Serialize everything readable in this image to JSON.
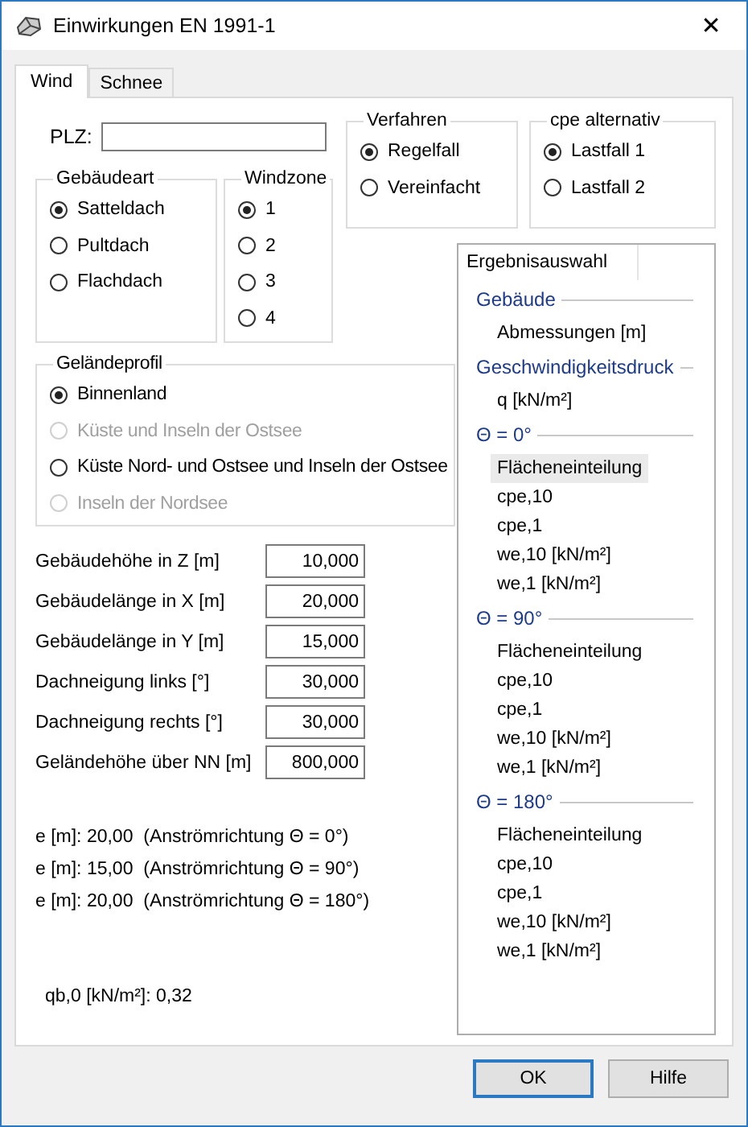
{
  "window": {
    "title": "Einwirkungen EN 1991-1",
    "close": "✕"
  },
  "tabs": [
    {
      "label": "Wind",
      "selected": true
    },
    {
      "label": "Schnee",
      "selected": false
    }
  ],
  "plz": {
    "label": "PLZ:"
  },
  "verfahren": {
    "title": "Verfahren",
    "options": [
      {
        "label": "Regelfall",
        "selected": true
      },
      {
        "label": "Vereinfacht",
        "selected": false
      }
    ]
  },
  "cpe_alternativ": {
    "title": "cpe alternativ",
    "options": [
      {
        "label": "Lastfall 1",
        "selected": true
      },
      {
        "label": "Lastfall 2",
        "selected": false
      }
    ]
  },
  "gebaeudeart": {
    "title": "Gebäudeart",
    "options": [
      {
        "label": "Satteldach",
        "selected": true
      },
      {
        "label": "Pultdach",
        "selected": false
      },
      {
        "label": "Flachdach",
        "selected": false
      }
    ]
  },
  "windzone": {
    "title": "Windzone",
    "options": [
      {
        "label": "1",
        "selected": true
      },
      {
        "label": "2",
        "selected": false
      },
      {
        "label": "3",
        "selected": false
      },
      {
        "label": "4",
        "selected": false
      }
    ]
  },
  "gelaendeprofil": {
    "title": "Geländeprofil",
    "options": [
      {
        "label": "Binnenland",
        "selected": true,
        "disabled": false
      },
      {
        "label": "Küste und Inseln der Ostsee",
        "selected": false,
        "disabled": true
      },
      {
        "label": "Küste Nord- und Ostsee und Inseln der Ostsee",
        "selected": false,
        "disabled": false
      },
      {
        "label": "Inseln der Nordsee",
        "selected": false,
        "disabled": true
      }
    ]
  },
  "inputs": [
    {
      "label": "Gebäudehöhe in Z [m]",
      "value": "10,000"
    },
    {
      "label": "Gebäudelänge in X [m]",
      "value": "20,000"
    },
    {
      "label": "Gebäudelänge in Y [m]",
      "value": "15,000"
    },
    {
      "label": "Dachneigung links [°]",
      "value": "30,000"
    },
    {
      "label": "Dachneigung rechts [°]",
      "value": "30,000"
    },
    {
      "label": "Geländehöhe über NN [m]",
      "value": "800,000"
    }
  ],
  "e_values": [
    "e [m]: 20,00  (Anströmrichtung Θ = 0°)",
    "e [m]: 15,00  (Anströmrichtung Θ = 90°)",
    "e [m]: 20,00  (Anströmrichtung Θ = 180°)"
  ],
  "qb": "qb,0 [kN/m²]: 0,32",
  "results": {
    "header": "Ergebnisauswahl",
    "groups": [
      {
        "title": "Gebäude",
        "items": [
          {
            "label": "Abmessungen [m]",
            "selected": false
          }
        ]
      },
      {
        "title": "Geschwindigkeitsdruck",
        "items": [
          {
            "label": "q [kN/m²]",
            "selected": false
          }
        ]
      },
      {
        "title": "Θ = 0°",
        "items": [
          {
            "label": "Flächeneinteilung",
            "selected": true
          },
          {
            "label": "cpe,10",
            "selected": false
          },
          {
            "label": "cpe,1",
            "selected": false
          },
          {
            "label": "we,10 [kN/m²]",
            "selected": false
          },
          {
            "label": "we,1 [kN/m²]",
            "selected": false
          }
        ]
      },
      {
        "title": "Θ = 90°",
        "items": [
          {
            "label": "Flächeneinteilung",
            "selected": false
          },
          {
            "label": "cpe,10",
            "selected": false
          },
          {
            "label": "cpe,1",
            "selected": false
          },
          {
            "label": "we,10 [kN/m²]",
            "selected": false
          },
          {
            "label": "we,1 [kN/m²]",
            "selected": false
          }
        ]
      },
      {
        "title": "Θ = 180°",
        "items": [
          {
            "label": "Flächeneinteilung",
            "selected": false
          },
          {
            "label": "cpe,10",
            "selected": false
          },
          {
            "label": "cpe,1",
            "selected": false
          },
          {
            "label": "we,10 [kN/m²]",
            "selected": false
          },
          {
            "label": "we,1 [kN/m²]",
            "selected": false
          }
        ]
      }
    ]
  },
  "buttons": [
    {
      "label": "OK",
      "default": true
    },
    {
      "label": "Hilfe",
      "default": false
    }
  ]
}
